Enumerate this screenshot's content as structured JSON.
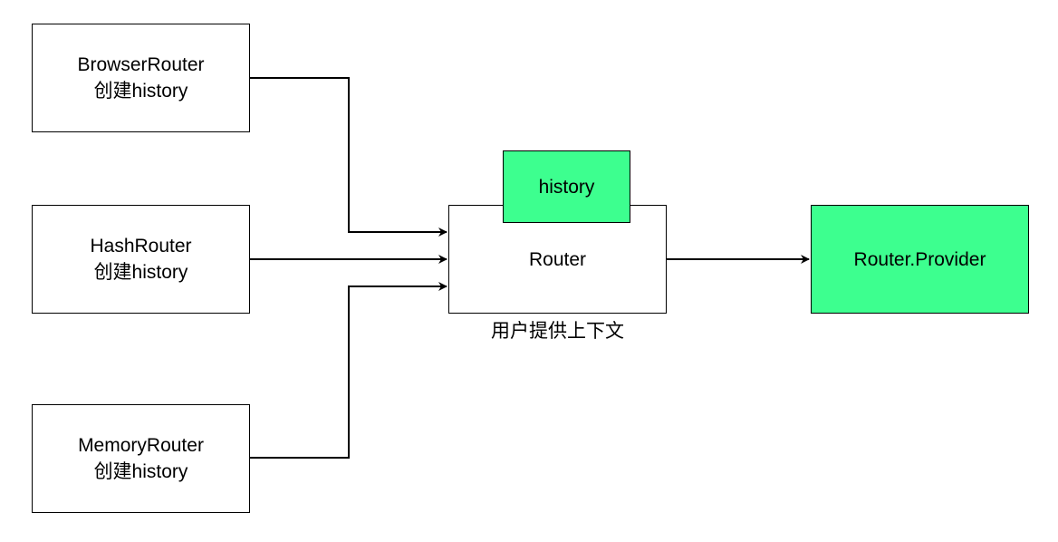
{
  "nodes": {
    "browser_router": {
      "line1": "BrowserRouter",
      "line2": "创建history"
    },
    "hash_router": {
      "line1": "HashRouter",
      "line2": "创建history"
    },
    "memory_router": {
      "line1": "MemoryRouter",
      "line2": "创建history"
    },
    "router": {
      "label": "Router",
      "caption": "用户提供上下文"
    },
    "history": {
      "label": "history"
    },
    "router_provider": {
      "label": "Router.Provider"
    }
  },
  "colors": {
    "highlight": "#3dff8f",
    "stroke": "#000000",
    "background": "#ffffff"
  }
}
